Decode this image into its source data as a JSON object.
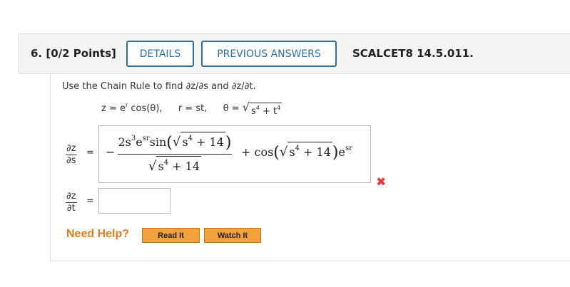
{
  "header": {
    "question": "6. [0/2 Points]",
    "details_label": "DETAILS",
    "previous_answers_label": "PREVIOUS ANSWERS",
    "code": "SCALCET8 14.5.011."
  },
  "problem": {
    "instruction": "Use the Chain Rule to find ∂z/∂s and ∂z/∂t.",
    "eq_z": "z = e",
    "eq_z_sup": "r",
    "eq_z_rest": " cos(θ),",
    "eq_r": "r = st,",
    "eq_theta_prefix": "θ = ",
    "eq_theta_radicand_s": "s",
    "eq_theta_radicand_plus": " + t",
    "exp4": "4"
  },
  "answers": {
    "dzds_num": "∂z",
    "dzds_den": "∂s",
    "dzdt_num": "∂z",
    "dzdt_den": "∂t",
    "equals": "=",
    "dzds_value": {
      "minus": "−",
      "num_a": "2s",
      "num_a_sup": "3",
      "num_e": "e",
      "num_e_sup": "sr",
      "num_sin": "sin",
      "rad_text": "s",
      "rad_sup": "4",
      "rad_plus": " + 14",
      "den_rad_text": "s",
      "den_rad_sup": "4",
      "den_plus": " + 14",
      "rest_plus_cos": "+ cos",
      "rest_rad_text": "s",
      "rest_rad_sup": "4",
      "rest_plus": " + 14",
      "rest_e": "e",
      "rest_e_sup": "sr"
    },
    "dzdt_value": "",
    "status": "incorrect",
    "status_color": "#e23b3b"
  },
  "help": {
    "need_help": "Need Help?",
    "read_it": "Read It",
    "watch_it": "Watch It"
  }
}
